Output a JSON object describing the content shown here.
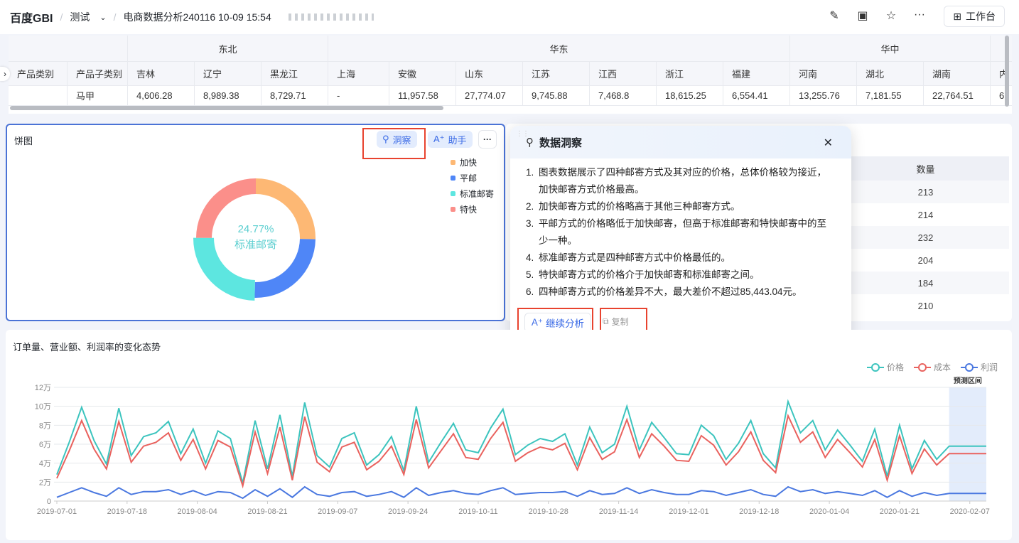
{
  "header": {
    "brand": "百度GBI",
    "space": "测试",
    "doc_title": "电商数据分析240116 10-09 15:54",
    "workbench": "工作台",
    "icons": [
      "edit-icon",
      "fullscreen-icon",
      "star-icon",
      "more-icon",
      "grid-icon"
    ]
  },
  "pivot": {
    "groups": [
      {
        "label": "东北",
        "span": 3
      },
      {
        "label": "华东",
        "span": 7
      },
      {
        "label": "华中",
        "span": 3
      },
      {
        "label": "",
        "span": 1
      }
    ],
    "row_headers": [
      "产品类别",
      "产品子类别"
    ],
    "columns": [
      "吉林",
      "辽宁",
      "黑龙江",
      "上海",
      "安徽",
      "山东",
      "江苏",
      "江西",
      "浙江",
      "福建",
      "河南",
      "湖北",
      "湖南",
      "内"
    ],
    "rows": [
      {
        "category": "",
        "subcategory": "马甲",
        "values": [
          "4,606.28",
          "8,989.38",
          "8,729.71",
          "-",
          "11,957.58",
          "27,774.07",
          "9,745.88",
          "7,468.8",
          "18,615.25",
          "6,554.41",
          "13,255.76",
          "7,181.55",
          "22,764.51",
          "6"
        ]
      }
    ]
  },
  "pie_card": {
    "title": "饼图",
    "insight_btn": "洞察",
    "assistant_btn": "助手",
    "center_value": "24.77%",
    "center_label": "标准邮寄"
  },
  "chart_data": [
    {
      "type": "pie",
      "variant": "donut",
      "title": "饼图",
      "categories": [
        "加快",
        "平邮",
        "标准邮寄",
        "特快"
      ],
      "values": [
        25.3,
        25.0,
        24.77,
        24.93
      ],
      "unit": "%",
      "highlighted": "标准邮寄",
      "colors": [
        "#fdb874",
        "#4f86f7",
        "#5de6e0",
        "#fb8f8a"
      ],
      "legend": "top-right"
    },
    {
      "type": "line",
      "title": "订单量、营业额、利润率的变化态势",
      "value_unit": "万",
      "ylim": [
        0,
        12
      ],
      "yticks": [
        "0",
        "2万",
        "4万",
        "6万",
        "8万",
        "10万",
        "12万"
      ],
      "ytick_values": [
        0,
        2,
        4,
        6,
        8,
        10,
        12
      ],
      "xticks": [
        "2019-07-01",
        "2019-07-18",
        "2019-08-04",
        "2019-08-21",
        "2019-09-07",
        "2019-09-24",
        "2019-10-11",
        "2019-10-28",
        "2019-11-14",
        "2019-12-01",
        "2019-12-18",
        "2020-01-04",
        "2020-01-21",
        "2020-02-07"
      ],
      "grid": true,
      "legend": "top-right",
      "forecast_label": "预测区间",
      "forecast_range": [
        "2020-02-02",
        "2020-02-11"
      ],
      "x": [
        "2019-07-01",
        "2019-07-04",
        "2019-07-07",
        "2019-07-10",
        "2019-07-13",
        "2019-07-16",
        "2019-07-19",
        "2019-07-22",
        "2019-07-25",
        "2019-07-28",
        "2019-07-31",
        "2019-08-03",
        "2019-08-06",
        "2019-08-09",
        "2019-08-12",
        "2019-08-15",
        "2019-08-18",
        "2019-08-21",
        "2019-08-24",
        "2019-08-27",
        "2019-08-30",
        "2019-09-02",
        "2019-09-05",
        "2019-09-08",
        "2019-09-11",
        "2019-09-14",
        "2019-09-17",
        "2019-09-20",
        "2019-09-23",
        "2019-09-26",
        "2019-09-29",
        "2019-10-02",
        "2019-10-05",
        "2019-10-08",
        "2019-10-11",
        "2019-10-14",
        "2019-10-17",
        "2019-10-20",
        "2019-10-23",
        "2019-10-26",
        "2019-10-29",
        "2019-11-01",
        "2019-11-04",
        "2019-11-07",
        "2019-11-10",
        "2019-11-13",
        "2019-11-16",
        "2019-11-19",
        "2019-11-22",
        "2019-11-25",
        "2019-11-28",
        "2019-12-01",
        "2019-12-04",
        "2019-12-07",
        "2019-12-10",
        "2019-12-13",
        "2019-12-16",
        "2019-12-19",
        "2019-12-22",
        "2019-12-25",
        "2019-12-28",
        "2019-12-31",
        "2020-01-03",
        "2020-01-06",
        "2020-01-09",
        "2020-01-12",
        "2020-01-15",
        "2020-01-18",
        "2020-01-21",
        "2020-01-24",
        "2020-01-27",
        "2020-01-30",
        "2020-02-02",
        "2020-02-05",
        "2020-02-08",
        "2020-02-11"
      ],
      "series": [
        {
          "name": "价格",
          "color": "#3cc4be",
          "values": [
            2.8,
            6.2,
            9.9,
            6.4,
            3.9,
            9.8,
            4.8,
            6.8,
            7.2,
            8.4,
            5.0,
            7.6,
            4.0,
            7.4,
            6.6,
            1.9,
            8.5,
            3.4,
            9.1,
            2.6,
            10.4,
            4.8,
            3.6,
            6.6,
            7.2,
            3.8,
            4.9,
            6.8,
            3.2,
            10.0,
            4.1,
            6.2,
            8.2,
            5.4,
            5.1,
            7.7,
            9.7,
            4.9,
            5.9,
            6.6,
            6.3,
            7.1,
            3.8,
            7.8,
            5.1,
            6.0,
            10.0,
            5.4,
            8.3,
            6.7,
            5.0,
            4.9,
            8.0,
            6.9,
            4.4,
            6.1,
            8.5,
            5.0,
            3.5,
            10.5,
            7.2,
            8.5,
            5.4,
            7.5,
            5.9,
            4.2,
            7.6,
            2.6,
            8.0,
            3.4,
            6.4,
            4.4,
            5.8,
            5.8,
            5.8,
            5.8
          ]
        },
        {
          "name": "成本",
          "color": "#e9625e",
          "values": [
            2.4,
            5.3,
            8.5,
            5.5,
            3.4,
            8.4,
            4.1,
            5.8,
            6.2,
            7.2,
            4.3,
            6.5,
            3.4,
            6.4,
            5.7,
            1.6,
            7.3,
            2.9,
            7.8,
            2.2,
            8.9,
            4.1,
            3.1,
            5.7,
            6.2,
            3.3,
            4.2,
            5.8,
            2.8,
            8.6,
            3.5,
            5.3,
            7.1,
            4.6,
            4.4,
            6.6,
            8.3,
            4.2,
            5.1,
            5.7,
            5.4,
            6.1,
            3.3,
            6.7,
            4.4,
            5.2,
            8.6,
            4.6,
            7.1,
            5.8,
            4.3,
            4.2,
            6.9,
            5.9,
            3.8,
            5.2,
            7.3,
            4.3,
            3.0,
            9.0,
            6.2,
            7.3,
            4.6,
            6.5,
            5.1,
            3.6,
            6.5,
            2.2,
            6.9,
            2.9,
            5.5,
            3.8,
            5.0,
            5.0,
            5.0,
            5.0
          ]
        },
        {
          "name": "利润",
          "color": "#4a78e0",
          "values": [
            0.4,
            0.9,
            1.4,
            0.9,
            0.5,
            1.4,
            0.7,
            1.0,
            1.0,
            1.2,
            0.7,
            1.1,
            0.6,
            1.0,
            0.9,
            0.3,
            1.2,
            0.5,
            1.3,
            0.4,
            1.5,
            0.7,
            0.5,
            0.9,
            1.0,
            0.5,
            0.7,
            1.0,
            0.4,
            1.4,
            0.6,
            0.9,
            1.1,
            0.8,
            0.7,
            1.1,
            1.4,
            0.7,
            0.8,
            0.9,
            0.9,
            1.0,
            0.5,
            1.1,
            0.7,
            0.8,
            1.4,
            0.8,
            1.2,
            0.9,
            0.7,
            0.7,
            1.1,
            1.0,
            0.6,
            0.9,
            1.2,
            0.7,
            0.5,
            1.5,
            1.0,
            1.2,
            0.8,
            1.0,
            0.8,
            0.6,
            1.1,
            0.4,
            1.1,
            0.5,
            0.9,
            0.6,
            0.8,
            0.8,
            0.8,
            0.8
          ]
        }
      ]
    }
  ],
  "quantity_table": {
    "header": "数量",
    "values": [
      "213",
      "214",
      "232",
      "204",
      "184",
      "210"
    ]
  },
  "insight_popup": {
    "title": "数据洞察",
    "items": [
      "图表数据展示了四种邮寄方式及其对应的价格，总体价格较为接近，加快邮寄方式价格最高。",
      "加快邮寄方式的价格略高于其他三种邮寄方式。",
      "平邮方式的价格略低于加快邮寄，但高于标准邮寄和特快邮寄中的至少一种。",
      "标准邮寄方式是四种邮寄方式中价格最低的。",
      "特快邮寄方式的价格介于加快邮寄和标准邮寄之间。",
      "四种邮寄方式的价格差异不大，最大差价不超过85,443.04元。"
    ],
    "continue_btn": "继续分析",
    "copy_btn": "复制"
  }
}
